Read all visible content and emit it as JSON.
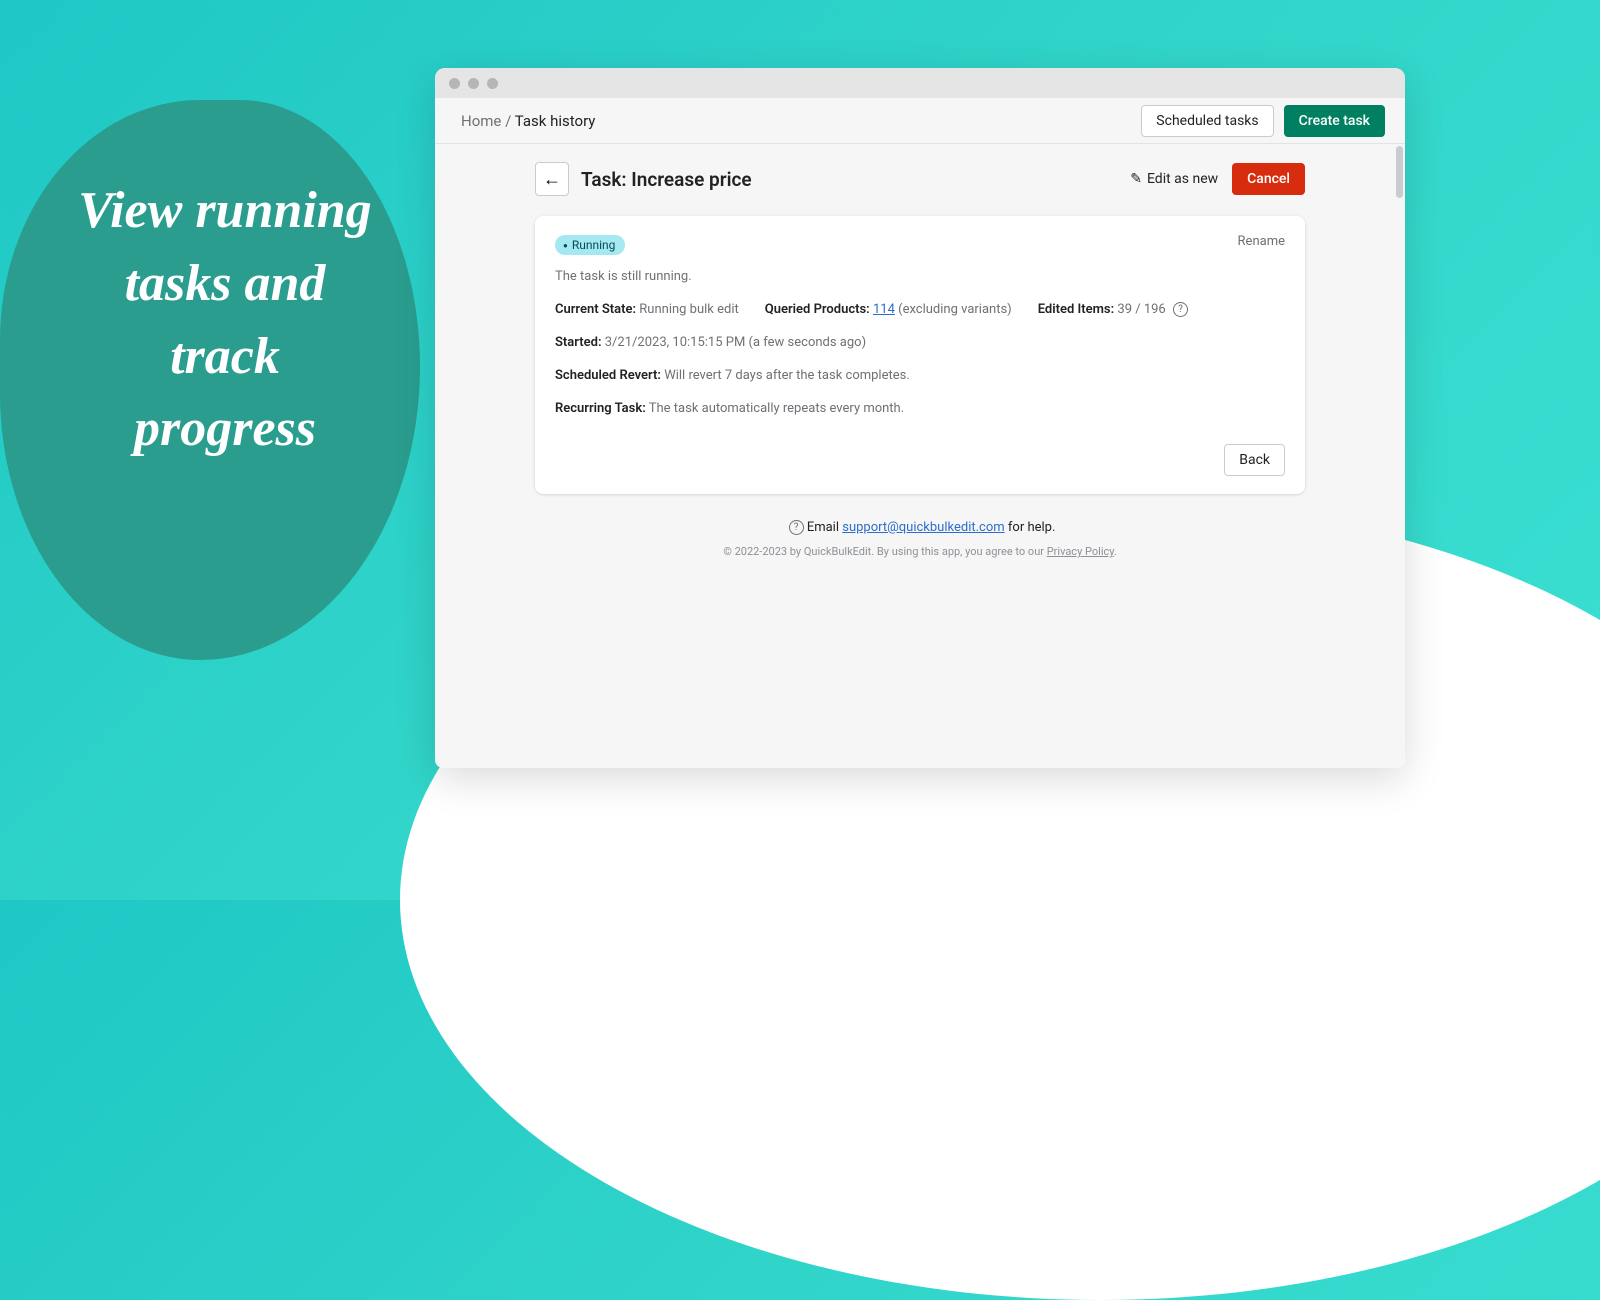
{
  "promo": "View running tasks and track progress",
  "breadcrumb": {
    "home": "Home",
    "sep": "/",
    "current": "Task history"
  },
  "header_actions": {
    "scheduled": "Scheduled tasks",
    "create": "Create task"
  },
  "task": {
    "title": "Task: Increase price",
    "edit_as_new": "Edit as new",
    "cancel": "Cancel",
    "badge": "Running",
    "rename": "Rename",
    "status_text": "The task is still running.",
    "current_state_label": "Current State:",
    "current_state_value": "Running bulk edit",
    "queried_label": "Queried Products:",
    "queried_value": "114",
    "queried_note": "(excluding variants)",
    "edited_label": "Edited Items:",
    "edited_value": "39 / 196",
    "started_label": "Started:",
    "started_value": "3/21/2023, 10:15:15 PM (a few seconds ago)",
    "revert_label": "Scheduled Revert:",
    "revert_value": "Will revert 7 days after the task completes.",
    "recurring_label": "Recurring Task:",
    "recurring_value": "The task automatically repeats every month.",
    "back": "Back"
  },
  "footer": {
    "help_prefix": "Email ",
    "help_email": "support@quickbulkedit.com",
    "help_suffix": " for help.",
    "legal_prefix": "© 2022-2023 by QuickBulkEdit. By using this app, you agree to our ",
    "legal_link": "Privacy Policy",
    "legal_suffix": "."
  }
}
